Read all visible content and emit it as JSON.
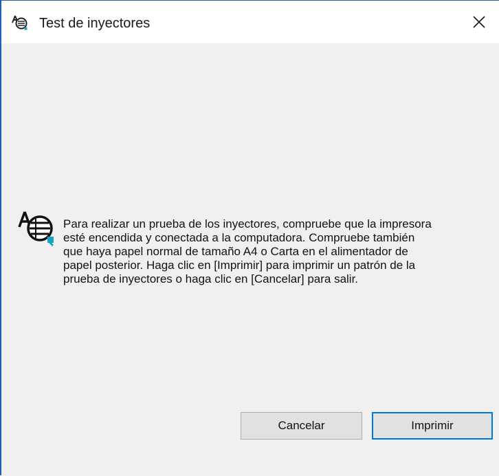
{
  "window": {
    "title": "Test de inyectores",
    "title_icon": "nozzle-check-icon",
    "close_icon": "close-icon"
  },
  "message": {
    "icon": "nozzle-check-icon",
    "lines": [
      "Para realizar un prueba de los inyectores, compruebe que la impresora",
      "esté encendida y conectada a la computadora. Compruebe también",
      "que haya papel normal de tamaño A4 o Carta en el alimentador de",
      "papel posterior. Haga clic en [Imprimir] para imprimir un patrón de la",
      "prueba de inyectores o haga clic en [Cancelar] para salir."
    ]
  },
  "buttons": {
    "cancel_label": "Cancelar",
    "print_label": "Imprimir"
  },
  "colors": {
    "window_border": "#1f5fb3",
    "dialog_background": "#f0f0f0",
    "default_button_border": "#0078d7"
  }
}
